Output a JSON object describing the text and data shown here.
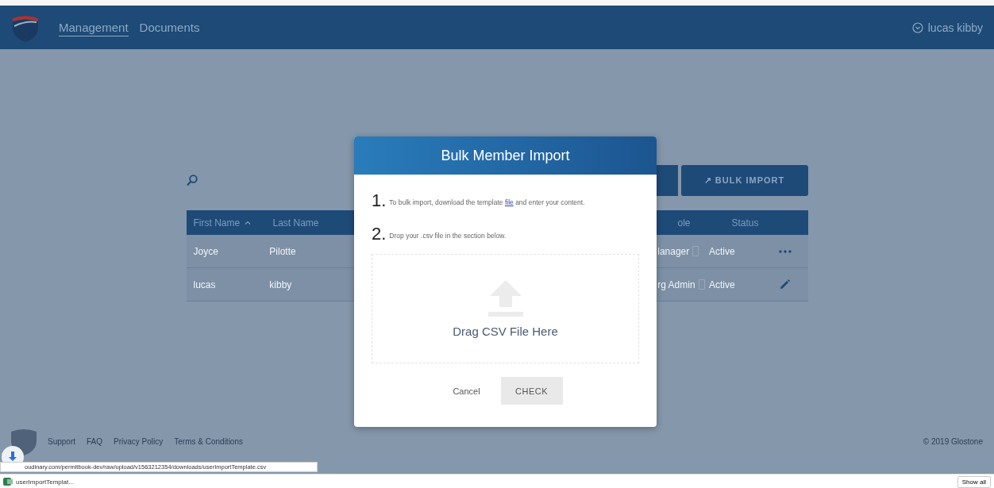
{
  "nav": {
    "items": [
      {
        "label": "Management",
        "selected": true
      },
      {
        "label": "Documents",
        "selected": false
      }
    ],
    "user": "lucas kibby"
  },
  "toolbar": {
    "icon": "↗",
    "bulk_import": "BULK IMPORT"
  },
  "table": {
    "columns": [
      {
        "label": "First Name",
        "sorted": true
      },
      {
        "label": "Last Name",
        "sorted": false
      },
      {
        "label": "ole",
        "sorted": false
      },
      {
        "label": "Status",
        "sorted": false
      }
    ],
    "rows": [
      {
        "first_name": "Joyce",
        "last_name": "Pilotte",
        "role": "lanager",
        "status": "Active",
        "kind": "more"
      },
      {
        "first_name": "lucas",
        "last_name": "kibby",
        "role": "rg Admin",
        "status": "Active",
        "kind": "edit"
      }
    ]
  },
  "modal": {
    "title": "Bulk Member Import",
    "steps": [
      {
        "number": "1.",
        "text": "To bulk import, download the template ",
        "link": "file",
        "text_after": " and enter your content."
      },
      {
        "number": "2.",
        "text": "Drop your .csv file in the section below."
      }
    ],
    "drop_label": "Drag CSV File Here",
    "cancel": "Cancel",
    "confirm": "CHECK"
  },
  "footer": {
    "links": [
      "Support",
      "FAQ",
      "Privacy Policy",
      "Terms & Conditions"
    ],
    "copyright": "© 2019 Glostone"
  },
  "browser": {
    "status_url": "oudinary.com/permitbook-dev/raw/upload/v1563212354/downloads/userImportTemplate.csv",
    "download": "userImportTemplat...",
    "show_all": "Show all"
  }
}
